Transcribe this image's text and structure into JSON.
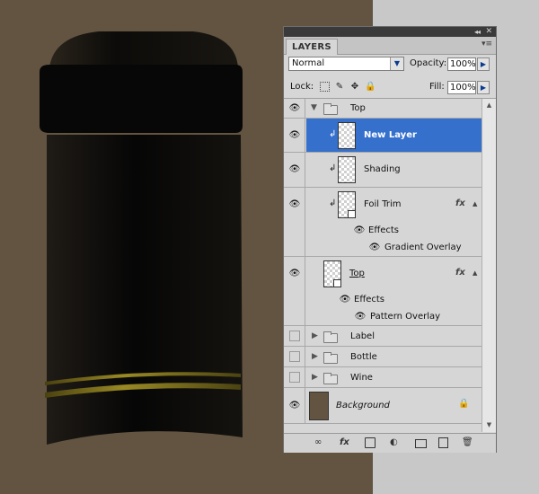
{
  "panel": {
    "tab_label": "LAYERS",
    "blend_mode": "Normal",
    "opacity_label": "Opacity:",
    "opacity_value": "100%",
    "lock_label": "Lock:",
    "fill_label": "Fill:",
    "fill_value": "100%"
  },
  "layers": {
    "top_group": "Top",
    "new_layer": "New Layer",
    "shading": "Shading",
    "foil_trim": "Foil Trim",
    "foil_effects": "Effects",
    "foil_gradient": "Gradient Overlay",
    "top_layer": "Top",
    "top_effects": "Effects",
    "top_pattern": "Pattern Overlay",
    "label_group": "Label",
    "bottle_group": "Bottle",
    "wine_group": "Wine",
    "background": "Background"
  },
  "icons": {
    "visibility": "eye-icon",
    "fx": "fx",
    "lock": "lock-icon"
  },
  "colors": {
    "selection": "#3570cc",
    "canvas_bg": "#625441",
    "gold": "#8a7a1e"
  }
}
